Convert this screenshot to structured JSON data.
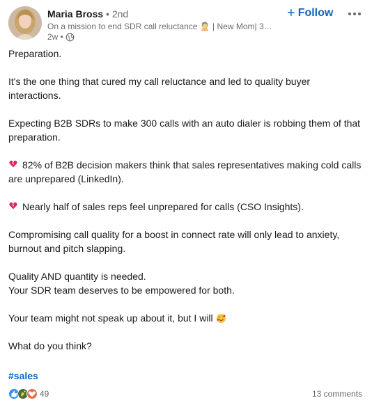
{
  "author": {
    "name": "Maria Bross",
    "degree": "• 2nd",
    "headline": "On a mission to end SDR call reluctance 🙎 | New Mom| 3X ...",
    "time": "2w •"
  },
  "actions": {
    "follow_icon": "+",
    "follow_label": "Follow",
    "more_icon": "more-horizontal-icon"
  },
  "post": {
    "lines": [
      "Preparation.",
      "It's the one thing that cured my call reluctance and led to quality buyer interactions.",
      "Expecting B2B SDRs to make 300 calls with an auto dialer is robbing them of that preparation.",
      "82% of B2B decision makers think that sales representatives making cold calls are unprepared (LinkedIn).",
      "Nearly half of sales reps feel unprepared for calls (CSO Insights).",
      "Compromising call quality for a boost in connect rate will only lead to anxiety, burnout and pitch slapping.",
      "Quality AND quantity is needed.",
      "Your SDR team deserves to be empowered for both.",
      "Your team might not speak up about it, but I will",
      "What do you think?"
    ],
    "hashtag": "#sales"
  },
  "social": {
    "reaction_count": "49",
    "comments": "13 comments"
  },
  "colors": {
    "link_blue": "#0a66c2",
    "broken_heart": "#e0245e",
    "like_blue": "#378fe9",
    "celebrate_green": "#44712e",
    "love_red": "#df704d"
  }
}
